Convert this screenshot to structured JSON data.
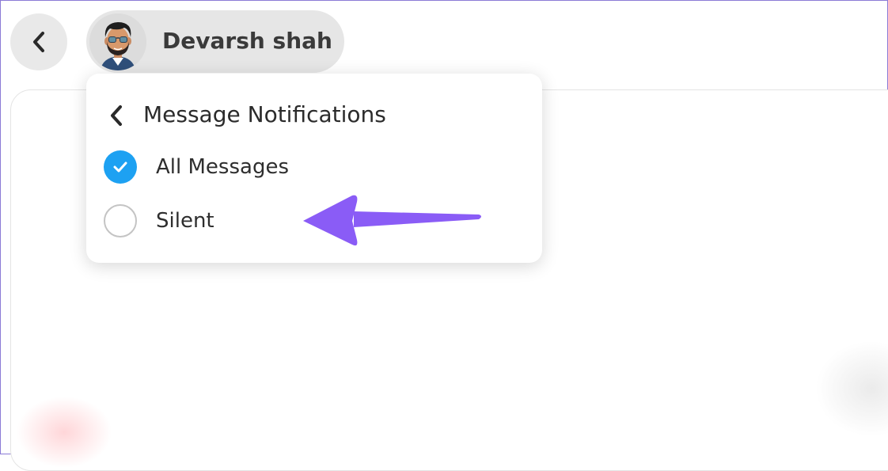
{
  "header": {
    "back_icon": "chevron-left-icon",
    "profile": {
      "name": "Devarsh shah",
      "avatar_icon": "bitmoji-avatar"
    }
  },
  "popup": {
    "back_icon": "chevron-left-icon",
    "title": "Message Notifications",
    "options": [
      {
        "label": "All Messages",
        "selected": true
      },
      {
        "label": "Silent",
        "selected": false
      }
    ]
  },
  "colors": {
    "accent_blue": "#1da1f2",
    "annotation_arrow": "#8a5cf6",
    "pill_bg": "#e6e6e6"
  }
}
